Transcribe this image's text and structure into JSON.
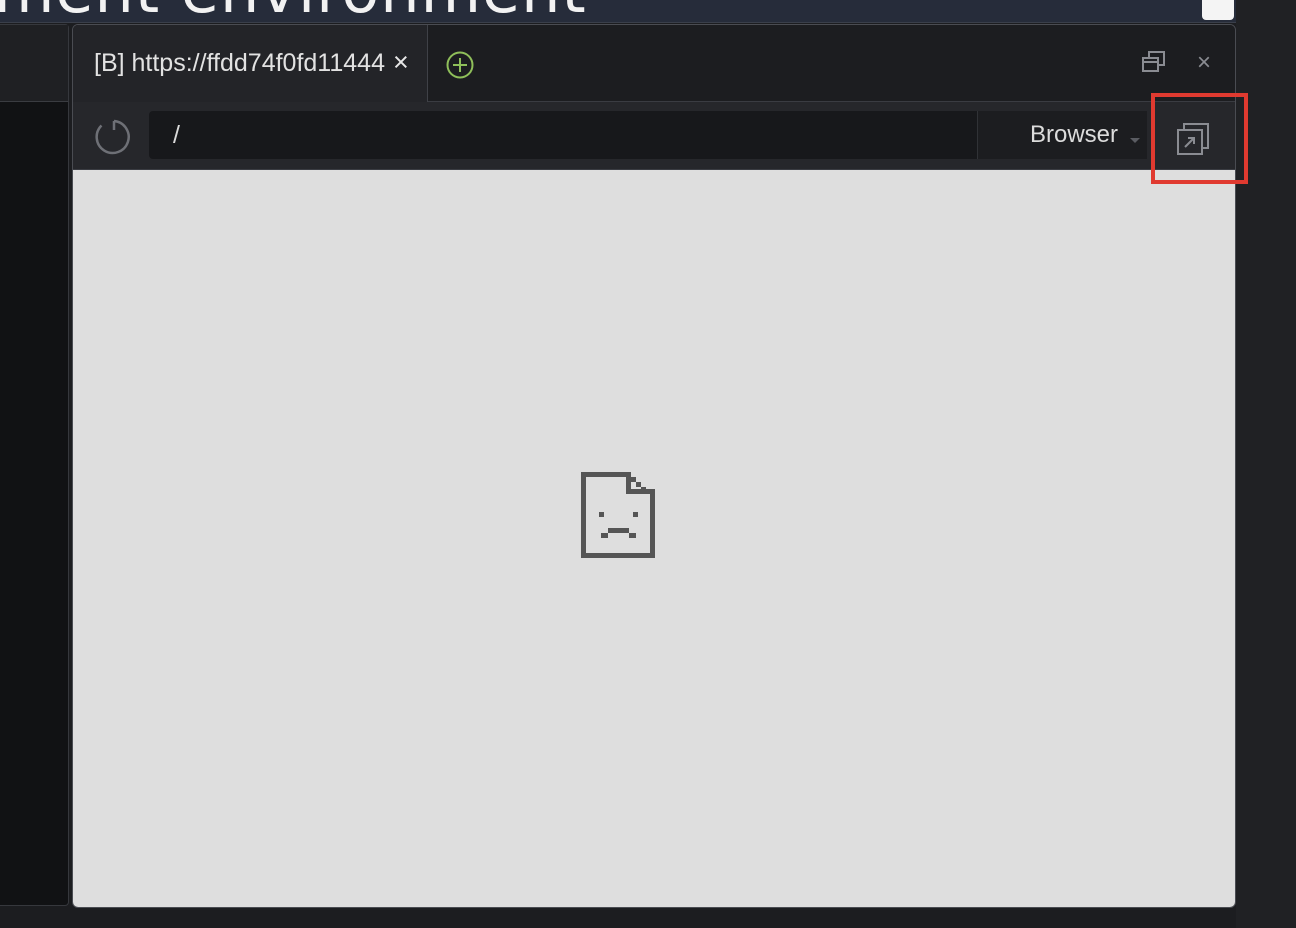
{
  "page": {
    "background_heading": "ment environment"
  },
  "browser_window": {
    "tab": {
      "title": "[B] https://ffdd74f0fd11444",
      "close_glyph": "×"
    },
    "new_tab_icon": "plus-circle-icon",
    "restore_icon": "restore-window-icon",
    "close_glyph": "×",
    "nav": {
      "reload_icon": "reload-icon",
      "address_value": "/",
      "browser_select_value": "Browser",
      "popout_icon": "popout-icon"
    },
    "content": {
      "error_icon": "sad-document-icon"
    }
  },
  "highlight": {
    "color": "#e03a30",
    "target": "popout-button"
  },
  "colors": {
    "accent_green": "#8fbf5a",
    "highlight_red": "#e03a30",
    "content_bg": "#dedede"
  }
}
